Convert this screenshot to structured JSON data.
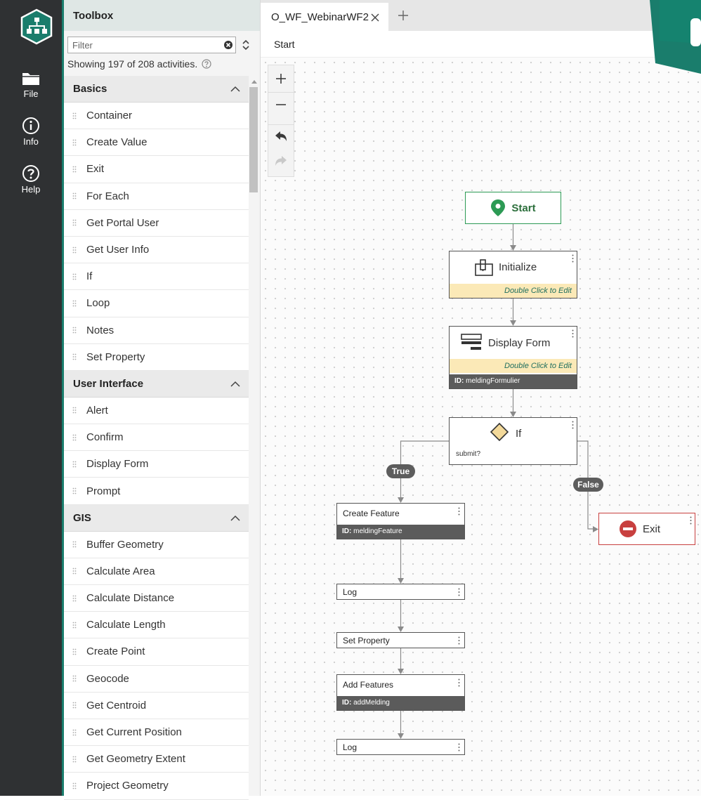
{
  "appbar": {
    "nav": [
      {
        "label": "File",
        "icon": "folder-icon"
      },
      {
        "label": "Info",
        "icon": "info-icon"
      },
      {
        "label": "Help",
        "icon": "help-icon"
      }
    ]
  },
  "toolbox": {
    "title": "Toolbox",
    "filter_placeholder": "Filter",
    "showing": "Showing 197 of 208 activities.",
    "groups": [
      {
        "name": "Basics",
        "items": [
          "Container",
          "Create Value",
          "Exit",
          "For Each",
          "Get Portal User",
          "Get User Info",
          "If",
          "Loop",
          "Notes",
          "Set Property"
        ]
      },
      {
        "name": "User Interface",
        "items": [
          "Alert",
          "Confirm",
          "Display Form",
          "Prompt"
        ]
      },
      {
        "name": "GIS",
        "items": [
          "Buffer Geometry",
          "Calculate Area",
          "Calculate Distance",
          "Calculate Length",
          "Create Point",
          "Geocode",
          "Get Centroid",
          "Get Current Position",
          "Get Geometry Extent",
          "Project Geometry"
        ]
      }
    ]
  },
  "tabs": {
    "active": "O_WF_WebinarWF2"
  },
  "breadcrumb": "Start",
  "flow": {
    "start": "Start",
    "initialize": "Initialize",
    "display_form": "Display Form",
    "double_click": "Double Click to Edit",
    "form_id_label": "ID:",
    "form_id": "meldingFormulier",
    "if_title": "If",
    "if_condition": "submit?",
    "true_label": "True",
    "false_label": "False",
    "exit": "Exit",
    "create_feature": "Create Feature",
    "create_id_label": "ID:",
    "create_id": "meldingFeature",
    "log1": "Log",
    "set_property": "Set Property",
    "add_features": "Add Features",
    "add_id_label": "ID:",
    "add_id": "addMelding",
    "log2": "Log"
  },
  "colors": {
    "accent": "#1a7d6c",
    "start_green": "#2c9a54",
    "exit_red": "#c8403f",
    "edit_bar": "#fbe9b7",
    "id_bar": "#5b5b5b"
  }
}
